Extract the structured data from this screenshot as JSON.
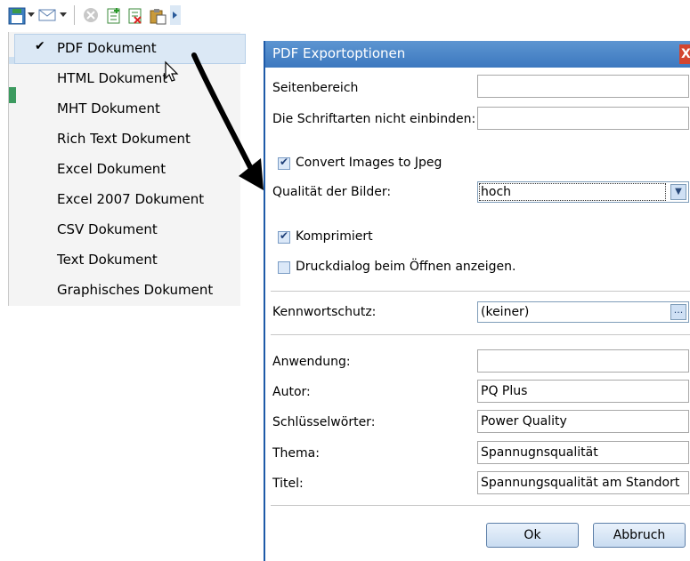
{
  "toolbar": {
    "icons": [
      "save-icon",
      "dropdown-arrow-icon",
      "email-icon",
      "dropdown-arrow-icon",
      "stop-icon",
      "add-sheet-icon",
      "delete-sheet-icon",
      "paste-icon",
      "more-icon"
    ]
  },
  "menu": {
    "items": [
      {
        "label": "PDF Dokument",
        "checked": true
      },
      {
        "label": "HTML Dokument"
      },
      {
        "label": "MHT Dokument"
      },
      {
        "label": "Rich Text Dokument"
      },
      {
        "label": "Excel Dokument"
      },
      {
        "label": "Excel 2007 Dokument"
      },
      {
        "label": "CSV Dokument"
      },
      {
        "label": "Text Dokument"
      },
      {
        "label": "Graphisches Dokument"
      }
    ]
  },
  "dialog": {
    "title": "PDF Exportoptionen",
    "close": "X",
    "page_range": {
      "label": "Seitenbereich",
      "value": ""
    },
    "no_embed_fonts": {
      "label": "Die Schriftarten nicht einbinden:",
      "value": ""
    },
    "convert_jpeg": {
      "label": "Convert Images to Jpeg",
      "checked": true
    },
    "image_quality": {
      "label": "Qualität der Bilder:",
      "value": "hoch"
    },
    "compressed": {
      "label": "Komprimiert",
      "checked": true
    },
    "print_dialog": {
      "label": "Druckdialog beim Öffnen anzeigen.",
      "checked": false
    },
    "password": {
      "label": "Kennwortschutz:",
      "value": "(keiner)",
      "button": "..."
    },
    "application": {
      "label": "Anwendung:",
      "value": ""
    },
    "author": {
      "label": "Autor:",
      "value": "PQ Plus"
    },
    "keywords": {
      "label": "Schlüsselwörter:",
      "value": "Power Quality"
    },
    "subject": {
      "label": "Thema:",
      "value": "Spannugnsqualität"
    },
    "title_field": {
      "label": "Titel:",
      "value": "Spannungsqualität am Standort"
    },
    "ok": "Ok",
    "cancel": "Abbruch"
  },
  "colors": {
    "titlebar": "#4a86c8",
    "menu_highlight": "#dbe8f5",
    "close_button": "#d3452f"
  }
}
